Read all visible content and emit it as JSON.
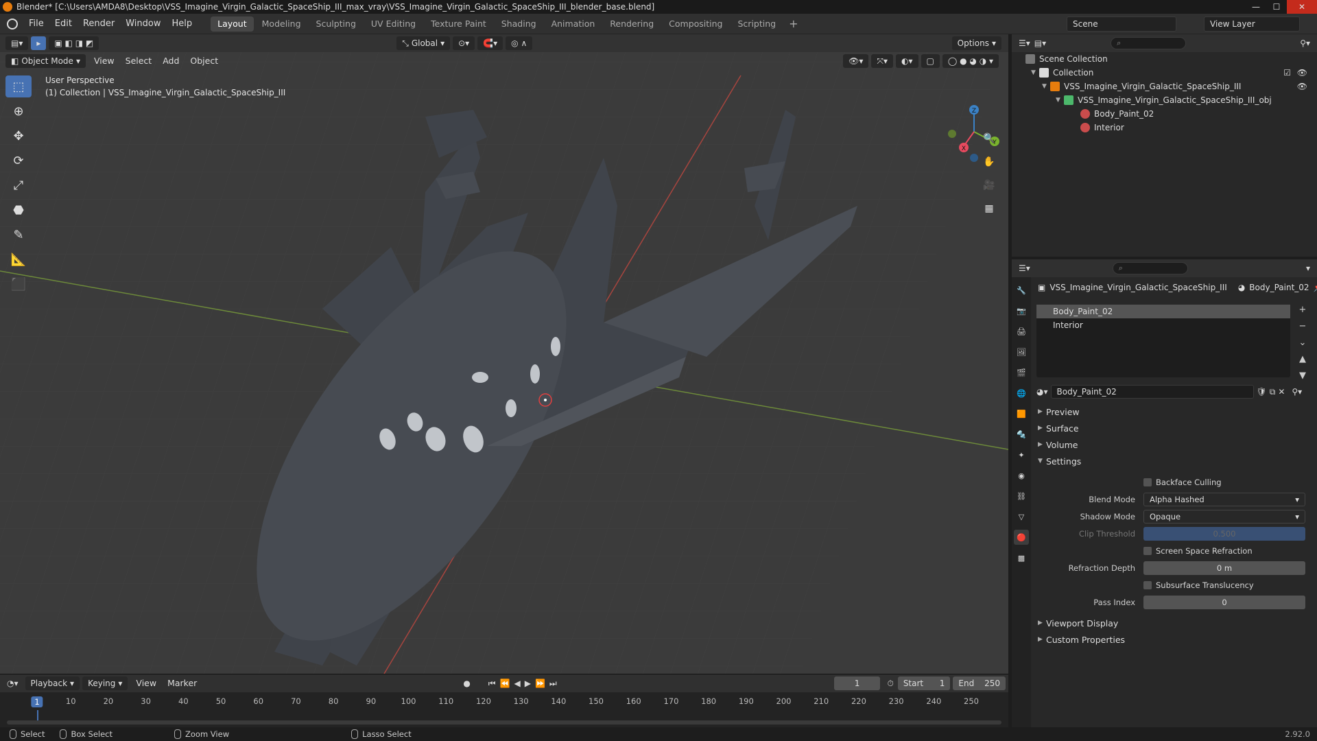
{
  "window": {
    "title": "Blender* [C:\\Users\\AMDA8\\Desktop\\VSS_Imagine_Virgin_Galactic_SpaceShip_III_max_vray\\VSS_Imagine_Virgin_Galactic_SpaceShip_III_blender_base.blend]"
  },
  "menu": [
    "File",
    "Edit",
    "Render",
    "Window",
    "Help"
  ],
  "workspaces": [
    "Layout",
    "Modeling",
    "Sculpting",
    "UV Editing",
    "Texture Paint",
    "Shading",
    "Animation",
    "Rendering",
    "Compositing",
    "Scripting"
  ],
  "scene": {
    "name": "Scene",
    "view_layer": "View Layer"
  },
  "viewport": {
    "transform_orientation": "Global",
    "options_label": "Options",
    "mode": "Object Mode",
    "menus": [
      "View",
      "Select",
      "Add",
      "Object"
    ],
    "info_line1": "User Perspective",
    "info_line2": "(1) Collection | VSS_Imagine_Virgin_Galactic_SpaceShip_III",
    "gizmo_x": "X",
    "gizmo_y": "Y",
    "gizmo_z": "Z"
  },
  "outliner": {
    "scene_collection": "Scene Collection",
    "items": [
      {
        "label": "Collection",
        "depth": 1
      },
      {
        "label": "VSS_Imagine_Virgin_Galactic_SpaceShip_III",
        "depth": 2
      },
      {
        "label": "VSS_Imagine_Virgin_Galactic_SpaceShip_III_obj",
        "depth": 3
      },
      {
        "label": "Body_Paint_02",
        "depth": 4
      },
      {
        "label": "Interior",
        "depth": 4
      }
    ]
  },
  "properties": {
    "breadcrumb_object": "VSS_Imagine_Virgin_Galactic_SpaceShip_III",
    "breadcrumb_material": "Body_Paint_02",
    "slots": [
      "Body_Paint_02",
      "Interior"
    ],
    "material_name": "Body_Paint_02",
    "panels": {
      "preview": "Preview",
      "surface": "Surface",
      "volume": "Volume",
      "settings": "Settings",
      "viewport_display": "Viewport Display",
      "custom_properties": "Custom Properties"
    },
    "settings": {
      "backface_culling": "Backface Culling",
      "blend_mode_label": "Blend Mode",
      "blend_mode_value": "Alpha Hashed",
      "shadow_mode_label": "Shadow Mode",
      "shadow_mode_value": "Opaque",
      "clip_threshold_label": "Clip Threshold",
      "clip_threshold_value": "0.500",
      "ssr_label": "Screen Space Refraction",
      "refraction_depth_label": "Refraction Depth",
      "refraction_depth_value": "0 m",
      "subsurface_label": "Subsurface Translucency",
      "pass_index_label": "Pass Index",
      "pass_index_value": "0"
    }
  },
  "timeline": {
    "menus": [
      "Playback",
      "Keying",
      "View",
      "Marker"
    ],
    "current_frame": "1",
    "start_label": "Start",
    "start_value": "1",
    "end_label": "End",
    "end_value": "250",
    "ticks": [
      "10",
      "20",
      "30",
      "40",
      "50",
      "60",
      "70",
      "80",
      "90",
      "100",
      "110",
      "120",
      "130",
      "140",
      "150",
      "160",
      "170",
      "180",
      "190",
      "200",
      "210",
      "220",
      "230",
      "240",
      "250"
    ],
    "current_tick": "1"
  },
  "statusbar": {
    "select": "Select",
    "box_select": "Box Select",
    "zoom_view": "Zoom View",
    "lasso_select": "Lasso Select",
    "version": "2.92.0"
  }
}
